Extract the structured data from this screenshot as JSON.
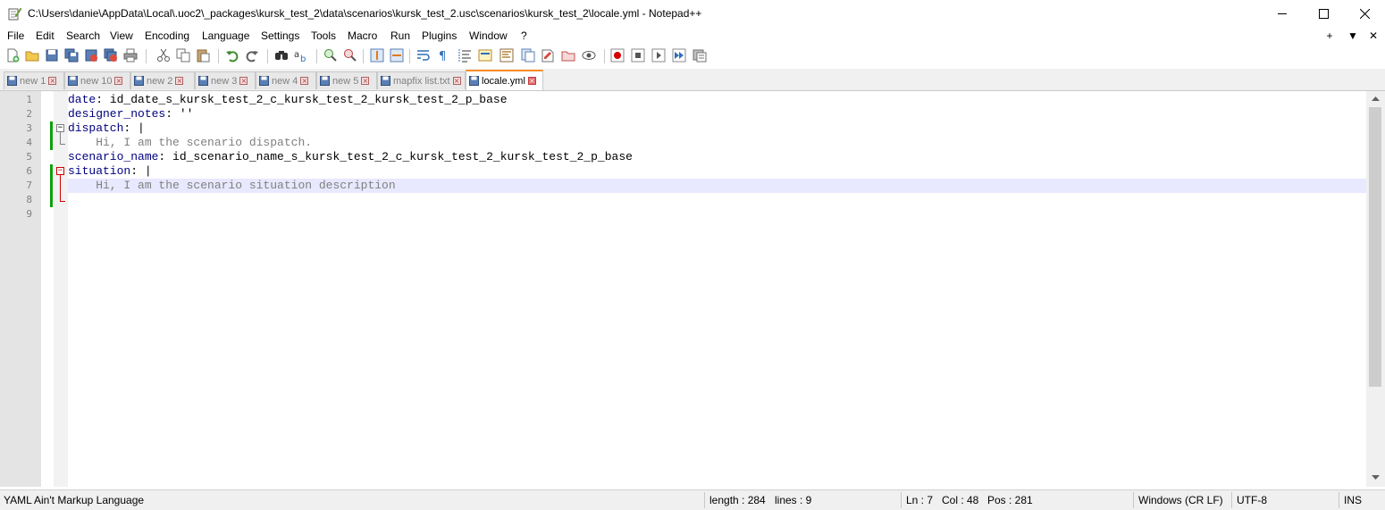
{
  "window": {
    "title": "C:\\Users\\danie\\AppData\\Local\\.uoc2\\_packages\\kursk_test_2\\data\\scenarios\\kursk_test_2.usc\\scenarios\\kursk_test_2\\locale.yml - Notepad++",
    "minimize": "—",
    "maximize": "☐",
    "close": "✕"
  },
  "menu": {
    "items": [
      "File",
      "Edit",
      "Search",
      "View",
      "Encoding",
      "Language",
      "Settings",
      "Tools",
      "Macro",
      "Run",
      "Plugins",
      "Window",
      "?"
    ],
    "right": [
      "+",
      "▼",
      "✕"
    ]
  },
  "toolbar": {
    "icons": [
      "new-file-icon",
      "open-file-icon",
      "save-icon",
      "save-all-icon",
      "close-icon",
      "close-all-icon",
      "print-icon",
      "cut-icon",
      "copy-icon",
      "paste-icon",
      "undo-icon",
      "redo-icon",
      "find-icon",
      "replace-icon",
      "zoom-in-icon",
      "zoom-out-icon",
      "sync-vertical-icon",
      "sync-horizontal-icon",
      "word-wrap-icon",
      "show-all-chars-icon",
      "indent-guide-icon",
      "udl-icon",
      "doc-map-icon",
      "function-list-icon",
      "folder-workspace-icon",
      "monitoring-icon",
      "record-macro-icon",
      "stop-macro-icon",
      "play-macro-icon",
      "run-macro-multiple-icon",
      "save-macro-icon"
    ]
  },
  "tabs": [
    {
      "label": "new 1",
      "active": false
    },
    {
      "label": "new 10",
      "active": false
    },
    {
      "label": "new 2",
      "active": false
    },
    {
      "label": "new 3",
      "active": false
    },
    {
      "label": "new 4",
      "active": false
    },
    {
      "label": "new 5",
      "active": false
    },
    {
      "label": "mapfix list.txt",
      "active": false
    },
    {
      "label": "locale.yml",
      "active": true
    }
  ],
  "editor": {
    "line_numbers": [
      "1",
      "2",
      "3",
      "4",
      "5",
      "6",
      "7",
      "8",
      "9"
    ],
    "lines": [
      {
        "key": "date",
        "sep": ": ",
        "value": "id_date_s_kursk_test_2_c_kursk_test_2_kursk_test_2_p_base"
      },
      {
        "key": "designer_notes",
        "sep": ": ",
        "value": "''"
      },
      {
        "key": "dispatch",
        "sep": ": ",
        "value": "|"
      },
      {
        "text": "    Hi, I am the scenario dispatch."
      },
      {
        "key": "scenario_name",
        "sep": ": ",
        "value": "id_scenario_name_s_kursk_test_2_c_kursk_test_2_kursk_test_2_p_base"
      },
      {
        "key": "situation",
        "sep": ": ",
        "value": "|"
      },
      {
        "text": "    Hi, I am the scenario situation description"
      },
      {
        "text": ""
      },
      {
        "text": ""
      }
    ],
    "current_line": 7
  },
  "status": {
    "language": "YAML Ain't Markup Language",
    "length": "length : 284",
    "lines": "lines : 9",
    "ln": "Ln : 7",
    "col": "Col : 48",
    "pos": "Pos : 281",
    "eol": "Windows (CR LF)",
    "encoding": "UTF-8",
    "mode": "INS"
  },
  "colors": {
    "key": "#000080",
    "comment_text": "#808080",
    "current_line_bg": "#e8e8ff",
    "active_tab_accent": "#fa8c28",
    "change_marker": "#0aa00a",
    "fold_red": "#d00000"
  }
}
